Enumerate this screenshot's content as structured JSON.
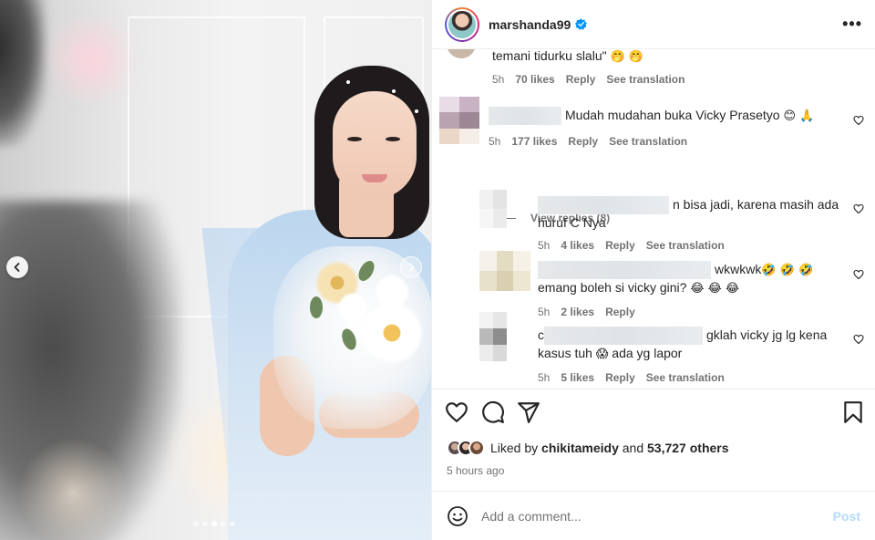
{
  "header": {
    "username": "marshanda99",
    "more_label": "•••"
  },
  "comments": [
    {
      "text": "temani tidurku slalu\"",
      "emoji": "🤭 🤭",
      "time": "5h",
      "likes": "70 likes",
      "reply": "Reply",
      "translate": "See translation"
    },
    {
      "text": "Mudah mudahan buka Vicky Prasetyo",
      "emoji": "😊 🙏",
      "time": "5h",
      "likes": "177 likes",
      "reply": "Reply",
      "translate": "See translation",
      "view_replies": "View replies (8)"
    }
  ],
  "replies": [
    {
      "line1": "n bisa jadi, karena masih ada",
      "line2": "huruf C Nya",
      "time": "5h",
      "likes": "4 likes",
      "reply": "Reply",
      "translate": "See translation"
    },
    {
      "line1": "wkwkwk",
      "line1_emoji": "🤣 🤣 🤣",
      "line2": "emang boleh si vicky gini?",
      "line2_emoji": "😂 😂 😂",
      "time": "5h",
      "likes": "2 likes",
      "reply": "Reply"
    },
    {
      "line1_prefix": "c",
      "line1": "gklah vicky jg lg kena",
      "line2": "kasus tuh",
      "line2_emoji": "😱",
      "line2_suffix": "ada yg lapor",
      "time": "5h",
      "likes": "5 likes",
      "reply": "Reply",
      "translate": "See translation"
    }
  ],
  "likes": {
    "prefix": "Liked by",
    "user": "chikitameidy",
    "and": "and",
    "count": "53,727 others"
  },
  "time_ago": "5 hours ago",
  "add_comment": {
    "placeholder": "Add a comment...",
    "post_label": "Post"
  },
  "carousel": {
    "total": 5,
    "active_index": 2
  },
  "colors": {
    "verified": "#0095f6",
    "text": "#262626",
    "muted": "#737373",
    "post_disabled": "#b3dbff"
  }
}
